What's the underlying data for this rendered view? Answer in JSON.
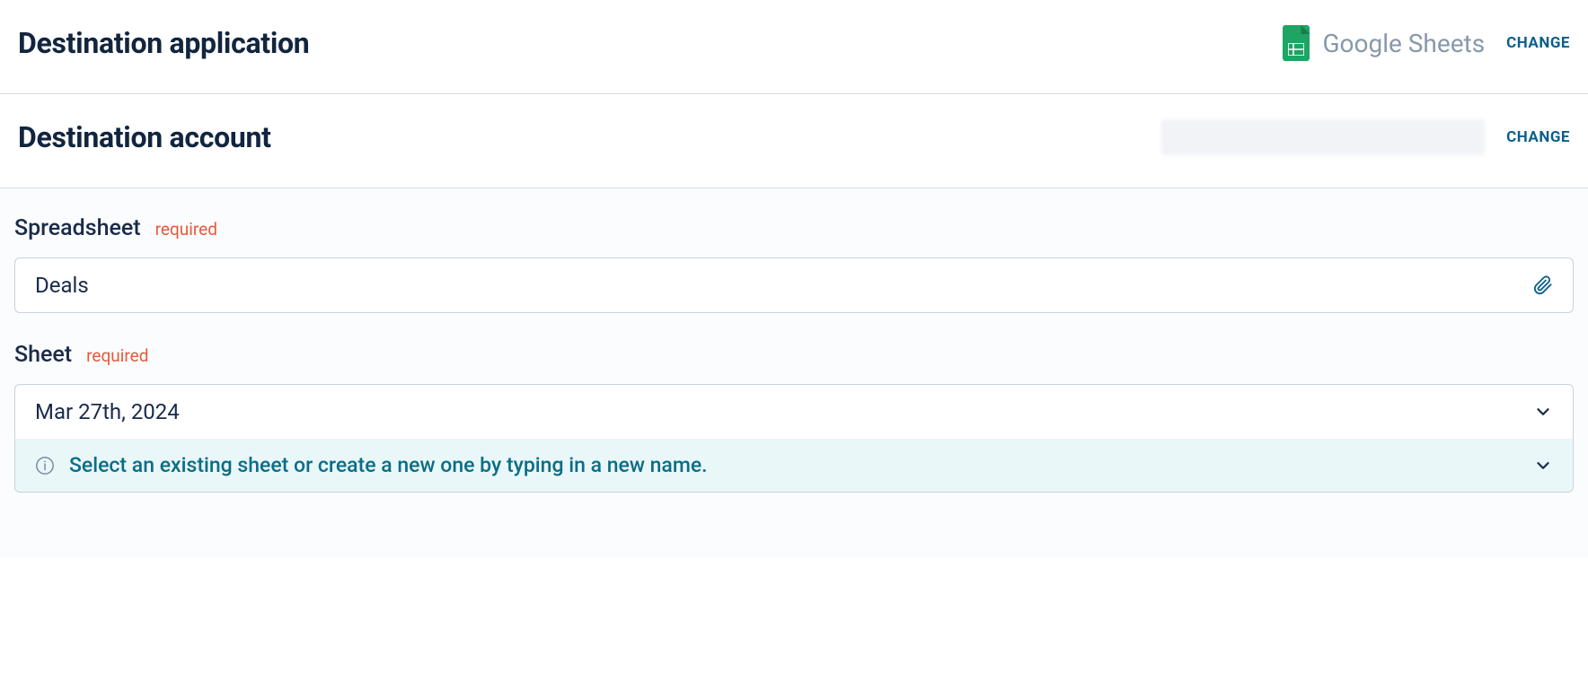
{
  "destination_app": {
    "title": "Destination application",
    "app_name": "Google Sheets",
    "change_label": "CHANGE"
  },
  "destination_account": {
    "title": "Destination account",
    "change_label": "CHANGE"
  },
  "spreadsheet": {
    "label": "Spreadsheet",
    "required_tag": "required",
    "value": "Deals"
  },
  "sheet": {
    "label": "Sheet",
    "required_tag": "required",
    "value": "Mar 27th, 2024",
    "info_text": "Select an existing sheet or create a new one by typing in a new name."
  }
}
